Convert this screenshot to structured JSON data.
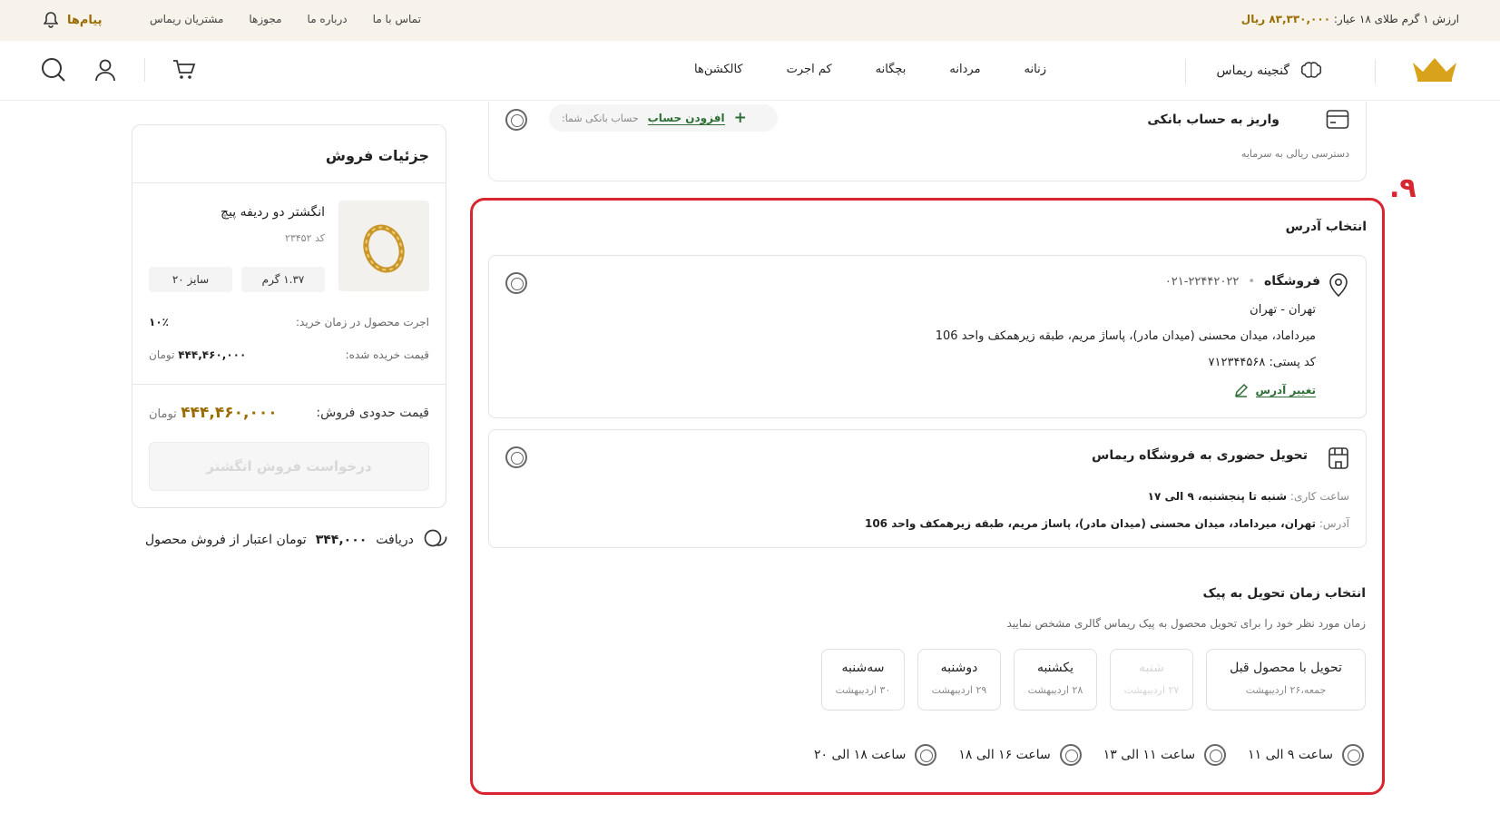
{
  "topbar": {
    "gold_label": "ارزش ۱ گرم طلای ۱۸ عیار:",
    "gold_value": "۸۳,۳۳۰,۰۰۰ ریال",
    "links": [
      "مشتریان ریماس",
      "مجوزها",
      "درباره ما",
      "تماس با ما"
    ],
    "messages_label": "پیام‌ها"
  },
  "header": {
    "brand": "گنجینه ریماس",
    "nav": [
      "زنانه",
      "مردانه",
      "بچگانه",
      "کم اجرت",
      "کالکشن‌ها"
    ]
  },
  "bank": {
    "title": "واریز به حساب بانکی",
    "subtitle": "دسترسی ریالی به سرمایه",
    "account_label": "حساب بانکی شما:",
    "add_account": "افزودن حساب"
  },
  "step_number": "۹.",
  "address_section": {
    "title": "انتخاب آدرس",
    "store": {
      "name": "فروشگاه",
      "phone": "۰۲۱-۲۲۴۴۲۰۲۲",
      "city": "تهران - تهران",
      "address": "میرداماد، میدان محسنی (میدان مادر)، پاساژ مریم، طبقه زیرهمکف واحد 106",
      "postal": "کد پستی: ۷۱۲۳۴۴۵۶۸",
      "change_address": "تغییر آدرس"
    },
    "pickup": {
      "title": "تحویل حضوری به فروشگاه ریماس",
      "hours_label": "ساعت کاری:",
      "hours_value": "شنبه تا پنجشنبه، ۹ الی ۱۷",
      "addr_label": "آدرس:",
      "addr_value": "تهران، میرداماد، میدان محسنی (میدان مادر)، پاساژ مریم، طبقه زیرهمکف واحد 106"
    }
  },
  "delivery": {
    "title": "انتخاب زمان تحویل به پیک",
    "subtitle": "زمان مورد نظر خود را برای تحویل محصول به پیک ریماس گالری مشخص نمایید",
    "days": [
      {
        "name": "تحویل با محصول قبل",
        "date": "جمعه،۲۶ اردیبهشت",
        "disabled": false
      },
      {
        "name": "شنبه",
        "date": "۲۷ اردیبهشت",
        "disabled": true
      },
      {
        "name": "یکشنبه",
        "date": "۲۸ اردیبهشت",
        "disabled": false
      },
      {
        "name": "دوشنبه",
        "date": "۲۹ اردیبهشت",
        "disabled": false
      },
      {
        "name": "سه‌شنبه",
        "date": "۳۰ اردیبهشت",
        "disabled": false
      }
    ],
    "slots": [
      "ساعت ۹ الی ۱۱",
      "ساعت ۱۱ الی ۱۳",
      "ساعت ۱۶ الی ۱۸",
      "ساعت ۱۸ الی ۲۰"
    ]
  },
  "sale": {
    "title": "جزئیات فروش",
    "product_name": "انگشتر دو ردیفه پیچ",
    "product_code": "کد ۲۳۴۵۲",
    "weight": "۱.۳۷ گرم",
    "size": "سایز ۲۰",
    "wage_label": "اجرت محصول در زمان خرید:",
    "wage_value": "۱۰٪",
    "purchase_label": "قیمت خریده شده:",
    "purchase_value": "۴۴۴,۴۶۰,۰۰۰",
    "currency": "تومان",
    "est_label": "قیمت حدودی فروش:",
    "est_value": "۴۴۴,۴۶۰,۰۰۰",
    "request_button": "درخواست فروش انگشتر"
  },
  "credit": {
    "pre": "دریافت",
    "amount": "۳۴۴,۰۰۰",
    "post": "تومان اعتبار از فروش محصول"
  }
}
